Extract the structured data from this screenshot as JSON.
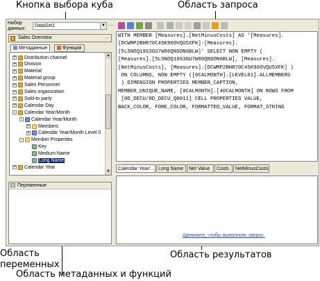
{
  "callouts": {
    "cube_button": "Кнопка выбора куба",
    "query_area": "Область запроса",
    "variables_area": "Область\nпеременных",
    "metadata_area": "Область метаданных и функций",
    "results_area": "Область результатов"
  },
  "toolbar": {
    "dataset_label_1": "Набор",
    "dataset_label_2": "данных:",
    "dataset_value": "DataSet1",
    "more_button": "..."
  },
  "cube": {
    "name": "Sales Overview",
    "more_button": "..."
  },
  "tabs": {
    "metadata": "Метаданные",
    "functions": "Функции"
  },
  "tree": [
    {
      "label": "Distribution channel",
      "expander": "+",
      "icon": "dimension-icon"
    },
    {
      "label": "Division",
      "expander": "+",
      "icon": "dimension-icon"
    },
    {
      "label": "Material",
      "expander": "+",
      "icon": "dimension-icon"
    },
    {
      "label": "Material group",
      "expander": "+",
      "icon": "dimension-icon"
    },
    {
      "label": "Sales Personnel",
      "expander": "+",
      "icon": "dimension-icon"
    },
    {
      "label": "Sales organization",
      "expander": "+",
      "icon": "dimension-icon"
    },
    {
      "label": "Sold-to party",
      "expander": "+",
      "icon": "dimension-icon"
    },
    {
      "label": "Calendar Day",
      "expander": "+",
      "icon": "dimension-icon"
    },
    {
      "label": "Calendar Year/Month",
      "expander": "-",
      "icon": "dimension-icon"
    },
    {
      "label": "Calendar Year/Month",
      "expander": "-",
      "icon": "hierarchy-icon"
    },
    {
      "label": "Members",
      "expander": "+",
      "icon": "folder-icon"
    },
    {
      "label": "Calendar Year/Month Level 0",
      "expander": "+",
      "icon": "level-icon"
    },
    {
      "label": "Member Properties",
      "expander": "-",
      "icon": "folder-icon"
    },
    {
      "label": "Key",
      "expander": "",
      "icon": "attribute-icon"
    },
    {
      "label": "Medium Name",
      "expander": "",
      "icon": "attribute-icon"
    },
    {
      "label": "Long Name",
      "expander": "",
      "icon": "attribute-icon"
    },
    {
      "label": "Calendar Year",
      "expander": "+",
      "icon": "dimension-icon"
    }
  ],
  "variables": {
    "title": "Переменные"
  },
  "query": {
    "lines": [
      "WITH MEMBER [Measures].[NetMinusCosts] AS '[Measures].",
      "[DCWMP2BHR70C45K96OVQU5XFK]-[Measures].",
      "[5L5NOQ19S3GU7W06QNSON6BLW]' SELECT NON EMPTY (",
      "[Measures].[5L5NOQ19S3GU7W06QNSON6BLW], [Measures].",
      "[NetMinusCosts], [Measures].[DCWMP2BHR70C45K96OVQU5XFK] )",
      " ON COLUMNS, NON EMPTY ([0CALMONTH].[LEVEL01].ALLMEMBERS",
      " ) DIMENSION PROPERTIES MEMBER_CAPTION,",
      "MEMBER_UNIQUE_NAME, [0CALMONTH].[40CALMONTH] ON ROWS FROM",
      " [0D_DECU/0D_DECU_Q0011] CELL PROPERTIES VALUE,",
      "BACK_COLOR, FORE_COLOR, FORMATTED_VALUE, FORMAT_STRING"
    ]
  },
  "results": {
    "columns": [
      "Calendar Year/...",
      "Long Name",
      "Net Value",
      "Costs",
      "NetMinusCosts"
    ],
    "execute_link": "Щелкните, чтобы выполнить запрос."
  },
  "colors": {
    "frame": "#ece9d8",
    "link": "#1f4fc6",
    "selection": "#0a246a"
  }
}
